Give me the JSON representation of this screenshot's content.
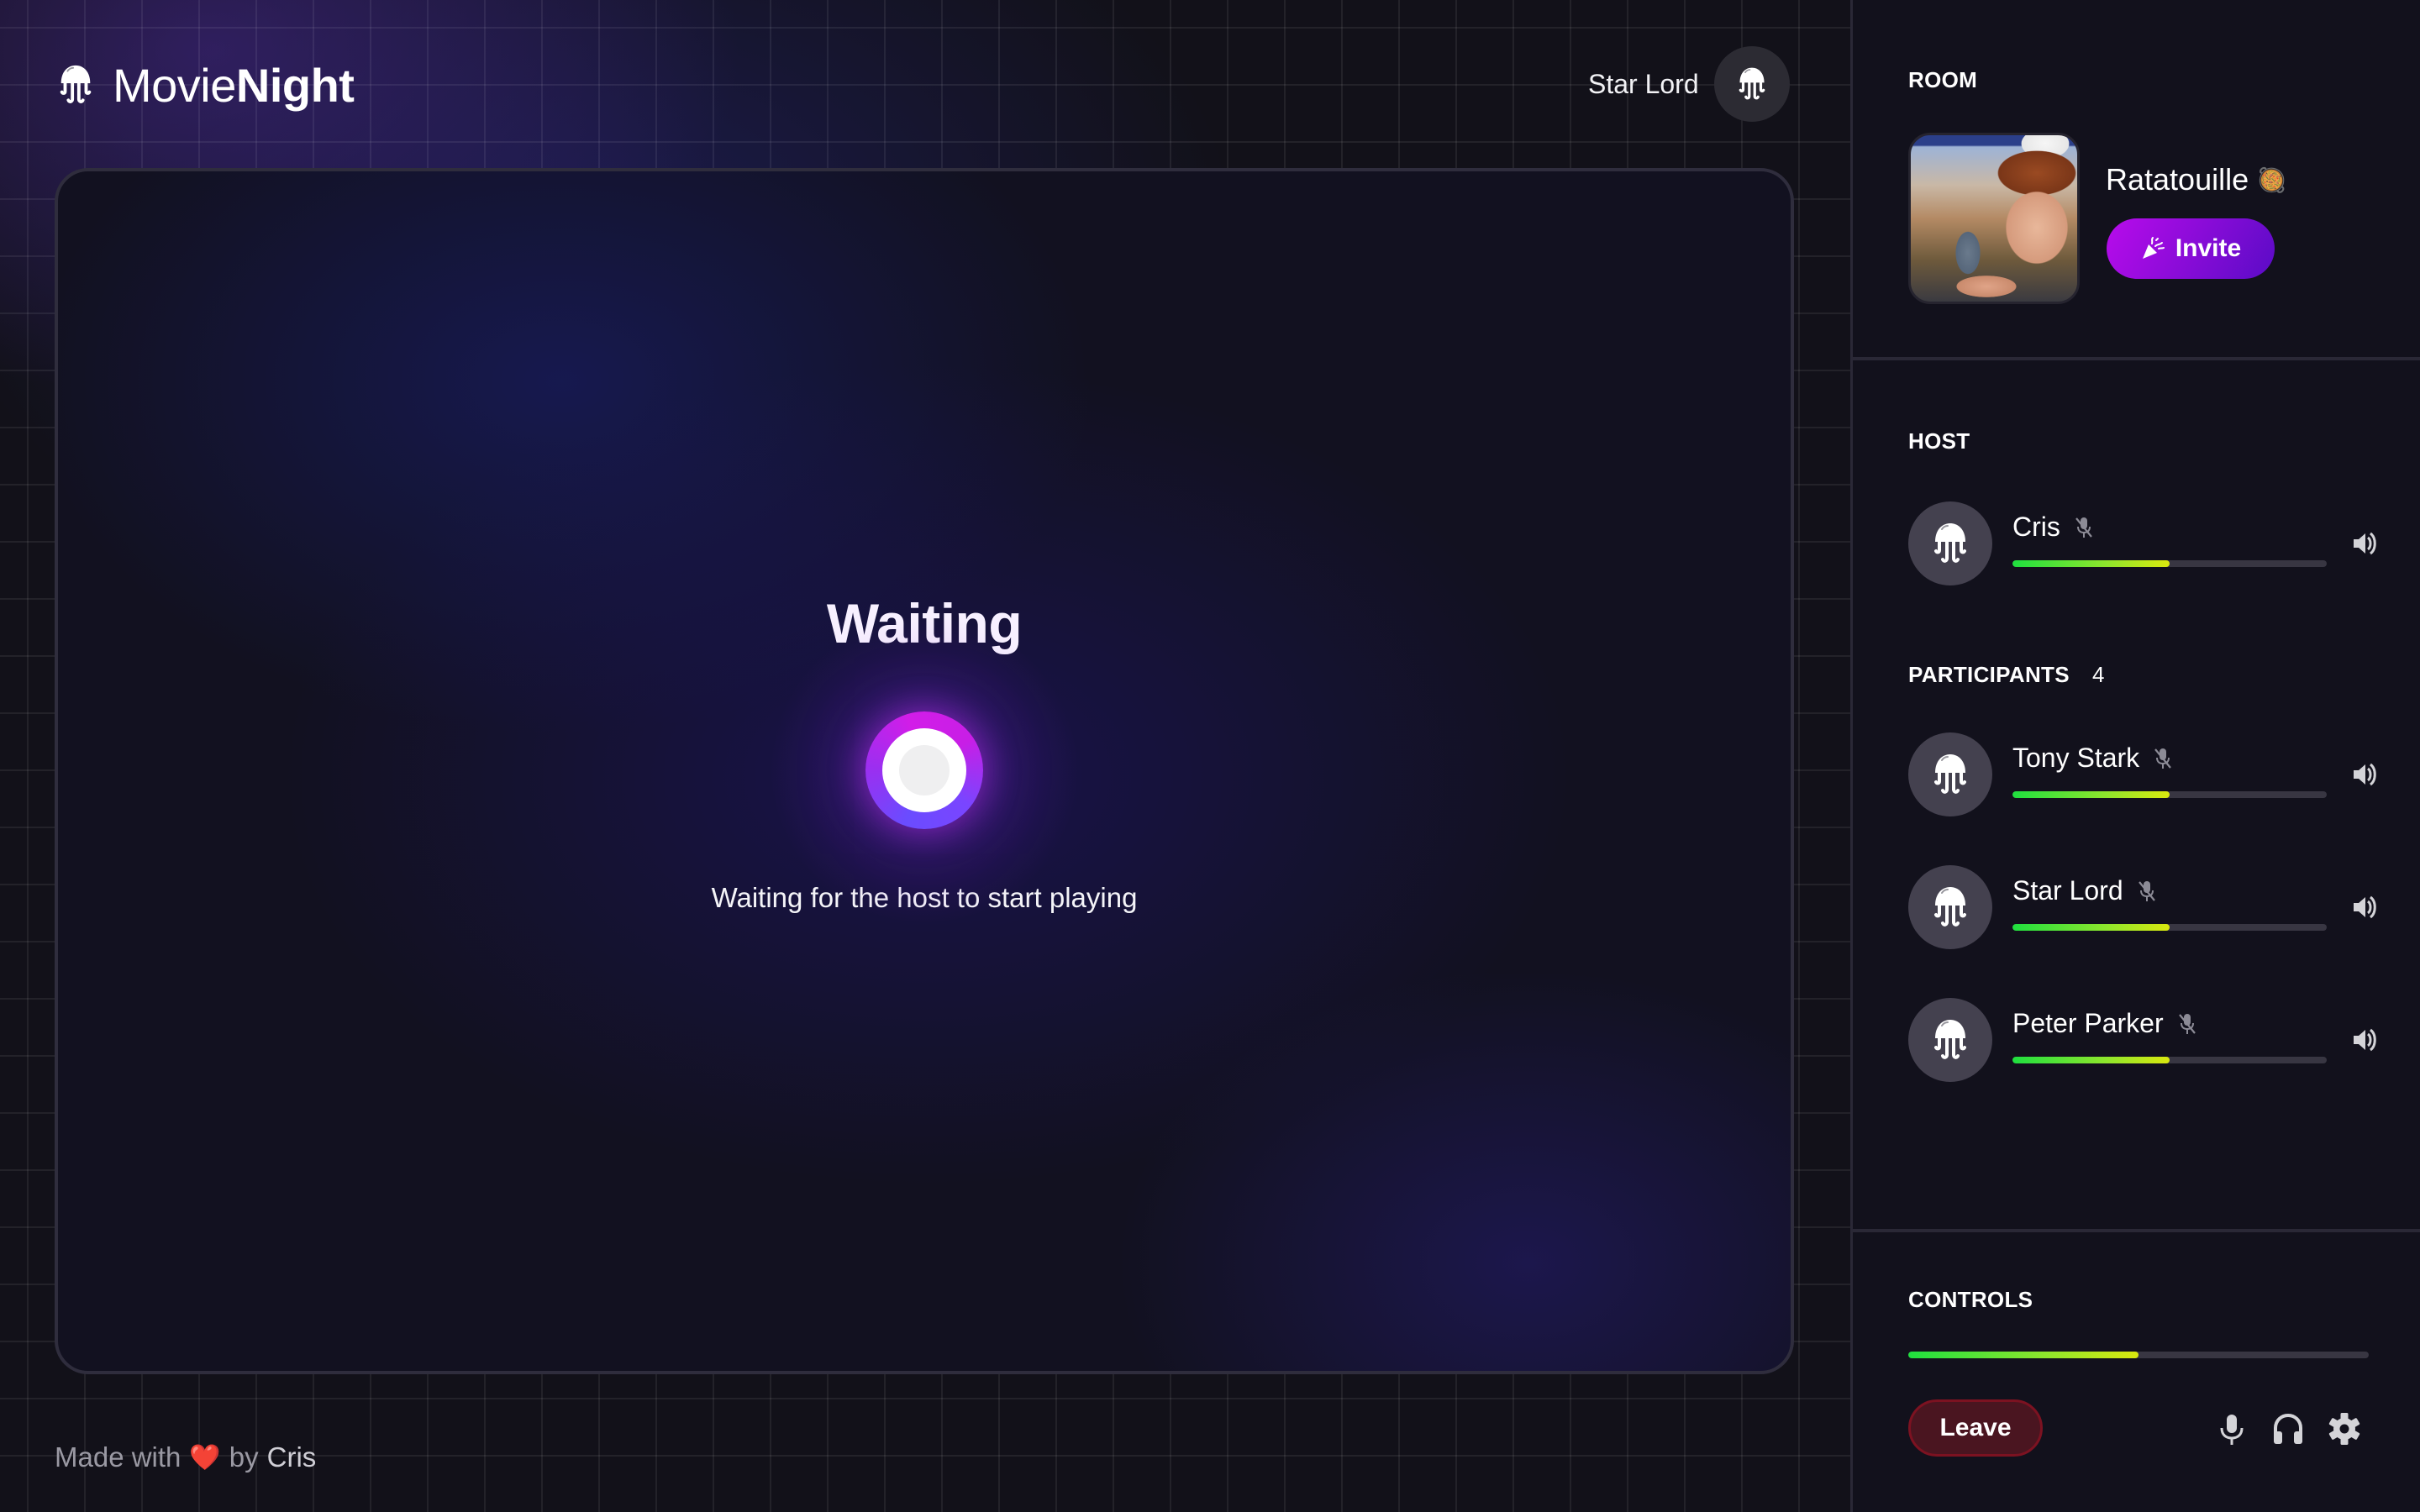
{
  "app": {
    "brand_light": "Movie",
    "brand_bold": "Night",
    "logo_icon": "jellyfish-icon"
  },
  "header": {
    "user_name": "Star Lord",
    "avatar_icon": "jellyfish-icon"
  },
  "stage": {
    "title": "Waiting",
    "subtitle": "Waiting for the host to start playing",
    "loader_icon": "pulsing-orb"
  },
  "footer": {
    "prefix": "Made with",
    "heart": "❤️",
    "by": "by",
    "author": "Cris"
  },
  "sidebar": {
    "room": {
      "label": "ROOM",
      "title": "Ratatouille",
      "emoji": "🥘",
      "poster_alt": "Ratatouille poster",
      "invite_label": "Invite",
      "invite_icon": "party-popper-icon"
    },
    "host": {
      "label": "HOST",
      "member": {
        "name": "Cris",
        "muted": true,
        "level": 0.5
      }
    },
    "participants": {
      "label": "PARTICIPANTS",
      "count": "4",
      "members": [
        {
          "name": "Tony Stark",
          "muted": true,
          "level": 0.5
        },
        {
          "name": "Star Lord",
          "muted": true,
          "level": 0.5
        },
        {
          "name": "Peter Parker",
          "muted": true,
          "level": 0.5
        }
      ]
    },
    "controls": {
      "label": "CONTROLS",
      "level": 0.5,
      "leave_label": "Leave",
      "icons": [
        "microphone-icon",
        "headphones-icon",
        "settings-gear-icon"
      ]
    }
  },
  "colors": {
    "accent_start": "#b80ceb",
    "accent_end": "#5a0bc6",
    "danger_bg": "#4a1520",
    "danger_border": "#7c1221",
    "avatar_bg": "#44414f",
    "meter_low": "#1fe03f",
    "meter_mid": "#ffea00",
    "meter_high": "#f01010"
  }
}
